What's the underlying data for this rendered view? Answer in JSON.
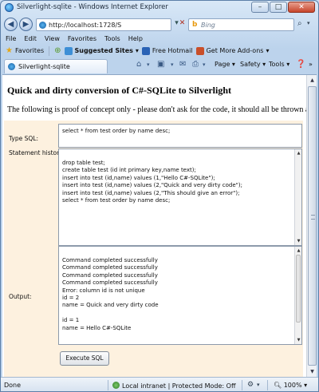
{
  "window": {
    "title": "Silverlight-sqlite - Windows Internet Explorer",
    "buttons": {
      "minimize": "–",
      "maximize": "□",
      "close": "✕"
    }
  },
  "address_bar": {
    "url": "http://localhost:1728/S",
    "search_placeholder": "Bing"
  },
  "menu": [
    "File",
    "Edit",
    "View",
    "Favorites",
    "Tools",
    "Help"
  ],
  "favorites_bar": {
    "favorites": "Favorites",
    "suggested": "Suggested Sites",
    "hotmail": "Free Hotmail",
    "addons": "Get More Add-ons"
  },
  "tab": {
    "label": "Silverlight-sqlite"
  },
  "command_bar": {
    "page": "Page",
    "safety": "Safety",
    "tools": "Tools"
  },
  "page": {
    "heading": "Quick and dirty conversion of C#-SQLite to Silverlight",
    "intro": "The following is proof of concept only - please don't ask for the code, it should all be thrown away.",
    "type_sql_label": "Type SQL:",
    "type_sql_value": "select * from test order by name desc;",
    "history_label": "Statement history",
    "history_lines": "drop table test;\ncreate table test (id int primary key,name text);\ninsert into test (id,name) values (1,\"Hello C#-SQLite\");\ninsert into test (id,name) values (2,\"Quick and very dirty code\");\ninsert into test (id,name) values (2,\"This should give an error\");\nselect * from test order by name desc;",
    "output_label": "Output:",
    "output_lines": "Command completed successfully\nCommand completed successfully\nCommand completed successfully\nCommand completed successfully\nError: column id is not unique\nid = 2\nname = Quick and very dirty code\n\nid = 1\nname = Hello C#-SQLite",
    "execute_button": "Execute SQL"
  },
  "status_bar": {
    "status": "Done",
    "zone": "Local intranet | Protected Mode: Off",
    "zoom": "100%"
  },
  "colors": {
    "silverlight_background": "#fdf1df",
    "chrome": "#c9dcf2"
  }
}
